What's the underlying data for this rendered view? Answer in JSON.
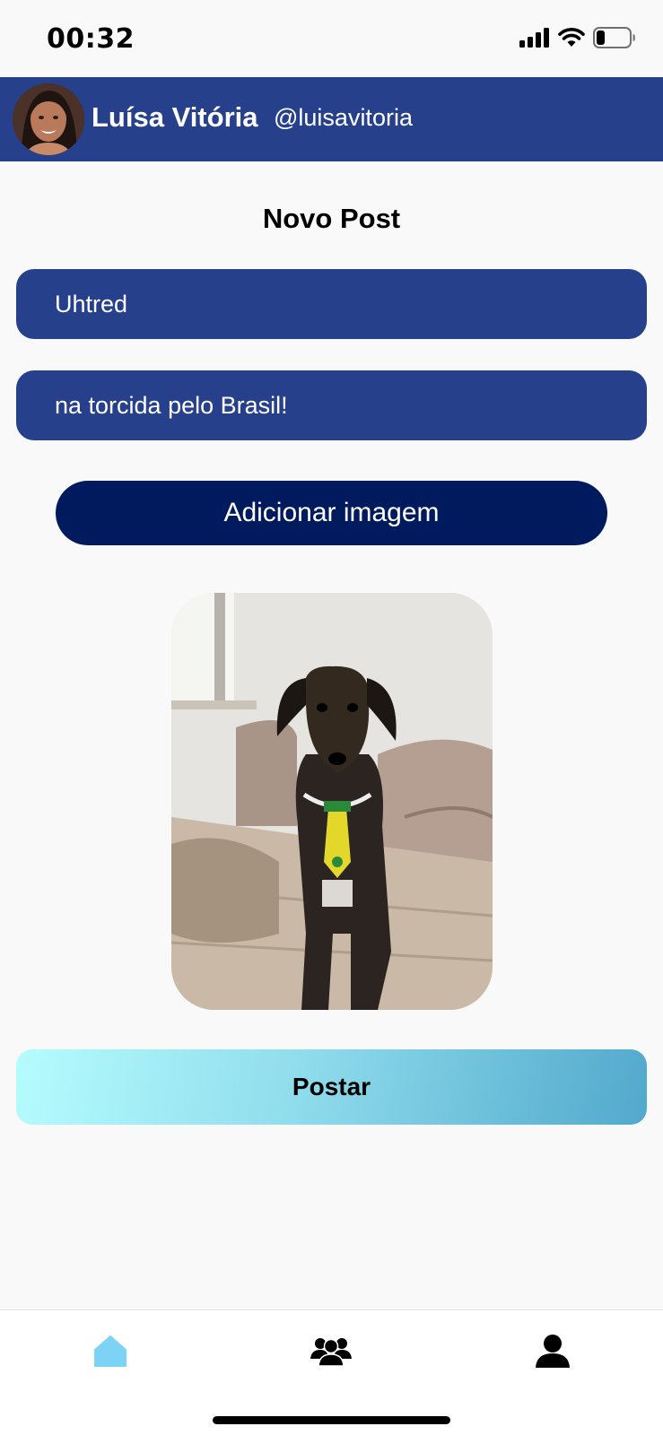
{
  "status_bar": {
    "time": "00:32",
    "battery_level": 0.2
  },
  "header": {
    "name": "Luísa Vitória",
    "handle": "@luisavitoria",
    "background": "#27408b"
  },
  "page": {
    "title": "Novo Post"
  },
  "form": {
    "name_value": "Uhtred",
    "caption_value": "na torcida pelo Brasil!",
    "add_image_label": "Adicionar imagem",
    "post_label": "Postar"
  },
  "bottom_nav": {
    "items": [
      {
        "icon": "home-icon",
        "active": true,
        "color": "#7dd3f5"
      },
      {
        "icon": "group-icon",
        "active": false,
        "color": "#000000"
      },
      {
        "icon": "profile-icon",
        "active": false,
        "color": "#000000"
      }
    ]
  }
}
